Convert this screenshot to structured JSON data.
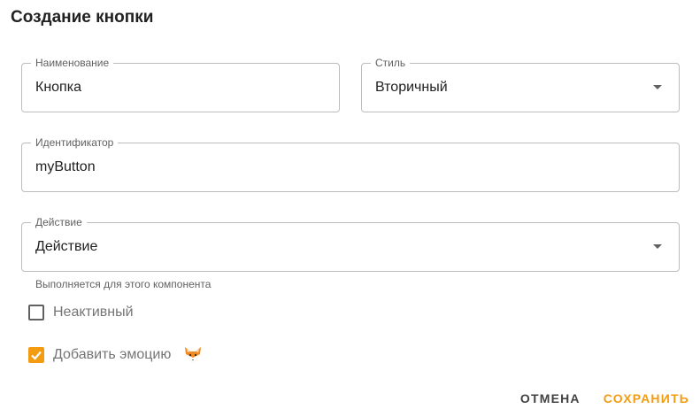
{
  "dialog": {
    "title": "Создание кнопки"
  },
  "fields": {
    "name": {
      "label": "Наименование",
      "value": "Кнопка"
    },
    "style": {
      "label": "Стиль",
      "value": "Вторичный"
    },
    "identifier": {
      "label": "Идентификатор",
      "value": "myButton"
    },
    "action": {
      "label": "Действие",
      "value": "Действие",
      "helper": "Выполняется для этого компонента"
    }
  },
  "checkboxes": {
    "inactive": {
      "label": "Неактивный",
      "checked": false
    },
    "emotion": {
      "label": "Добавить эмоцию",
      "checked": true,
      "icon": "fox-icon"
    }
  },
  "actions": {
    "cancel_label": "ОТМЕНА",
    "save_label": "СОХРАНИТЬ"
  },
  "colors": {
    "accent": "#f39c12",
    "border": "#bdbdbd",
    "text": "#212121",
    "muted": "#757575"
  }
}
